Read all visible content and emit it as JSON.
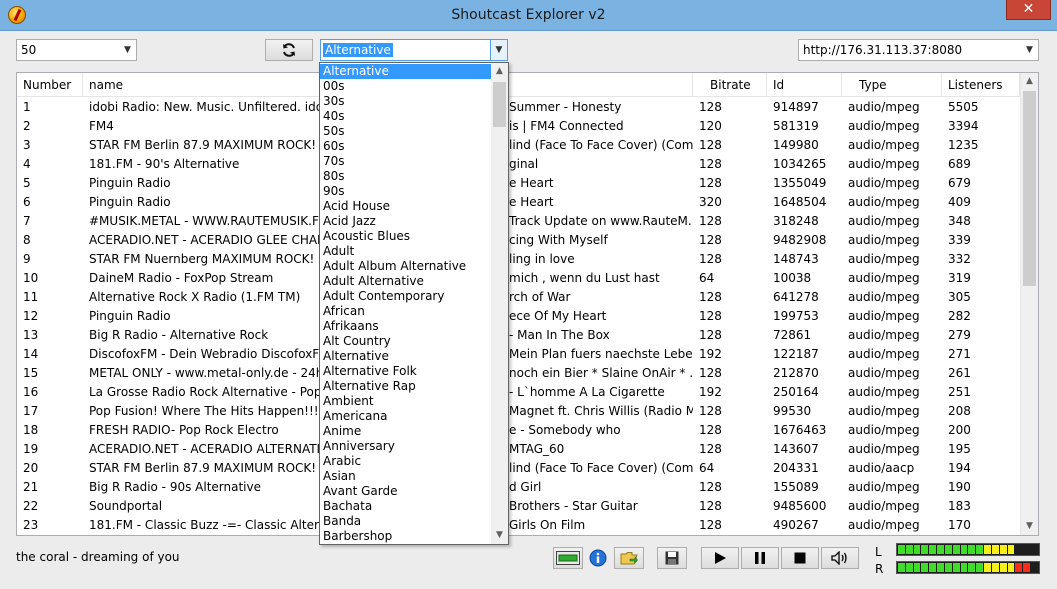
{
  "window": {
    "title": "Shoutcast Explorer v2",
    "close_glyph": "✕"
  },
  "toolbar": {
    "limit_value": "50",
    "refresh_icon": "refresh-icon",
    "genre_value": "Alternative",
    "server_value": "http://176.31.113.37:8080"
  },
  "table": {
    "columns": [
      "Number",
      "name",
      "Bitrate",
      "Id",
      "Type",
      "Listeners"
    ],
    "rows": [
      {
        "number": "1",
        "name": "idobi Radio: New. Music. Unfiltered. idobi.co",
        "song": "Summer - Honesty",
        "bitrate": "128",
        "id": "914897",
        "type": "audio/mpeg",
        "listeners": "5505"
      },
      {
        "number": "2",
        "name": "FM4",
        "song": "is | FM4 Connected",
        "bitrate": "120",
        "id": "581319",
        "type": "audio/mpeg",
        "listeners": "3394"
      },
      {
        "number": "3",
        "name": "STAR FM Berlin 87.9  MAXIMUM ROCK!",
        "song": "lind (Face To Face Cover) (Com...",
        "bitrate": "128",
        "id": "149980",
        "type": "audio/mpeg",
        "listeners": "1235"
      },
      {
        "number": "4",
        "name": "181.FM - 90's Alternative",
        "song": "ginal",
        "bitrate": "128",
        "id": "1034265",
        "type": "audio/mpeg",
        "listeners": "689"
      },
      {
        "number": "5",
        "name": "Pinguin Radio",
        "song": "e Heart",
        "bitrate": "128",
        "id": "1355049",
        "type": "audio/mpeg",
        "listeners": "679"
      },
      {
        "number": "6",
        "name": "Pinguin Radio",
        "song": "e Heart",
        "bitrate": "320",
        "id": "1648504",
        "type": "audio/mpeg",
        "listeners": "409"
      },
      {
        "number": "7",
        "name": "#MUSIK.METAL - WWW.RAUTEMUSIK.FM - 2",
        "song": "Track Update on www.RauteM...",
        "bitrate": "128",
        "id": "318248",
        "type": "audio/mpeg",
        "listeners": "348"
      },
      {
        "number": "8",
        "name": "ACERADIO.NET - ACERADIO GLEE CHANNE",
        "song": "cing With Myself",
        "bitrate": "128",
        "id": "9482908",
        "type": "audio/mpeg",
        "listeners": "339"
      },
      {
        "number": "9",
        "name": "STAR FM Nuernberg MAXIMUM ROCK!",
        "song": "ling in love",
        "bitrate": "128",
        "id": "148743",
        "type": "audio/mpeg",
        "listeners": "332"
      },
      {
        "number": "10",
        "name": "DaineM Radio - FoxPop Stream",
        "song": "mich , wenn du Lust hast",
        "bitrate": "64",
        "id": "10038",
        "type": "audio/mpeg",
        "listeners": "319"
      },
      {
        "number": "11",
        "name": "Alternative Rock X Radio (1.FM TM)",
        "song": "rch of War",
        "bitrate": "128",
        "id": "641278",
        "type": "audio/mpeg",
        "listeners": "305"
      },
      {
        "number": "12",
        "name": "Pinguin Radio",
        "song": "ece Of My Heart",
        "bitrate": "128",
        "id": "199753",
        "type": "audio/mpeg",
        "listeners": "282"
      },
      {
        "number": "13",
        "name": "Big R Radio - Alternative Rock",
        "song": "- Man In The Box",
        "bitrate": "128",
        "id": "72861",
        "type": "audio/mpeg",
        "listeners": "279"
      },
      {
        "number": "14",
        "name": "DiscofoxFM - Dein Webradio DiscofoxFM - N",
        "song": "Mein Plan fuers naechste Leben",
        "bitrate": "192",
        "id": "122187",
        "type": "audio/mpeg",
        "listeners": "271"
      },
      {
        "number": "15",
        "name": "METAL ONLY - www.metal-only.de - 24h Bl",
        "song": "noch ein Bier * Slaine OnAir * ...",
        "bitrate": "128",
        "id": "212870",
        "type": "audio/mpeg",
        "listeners": "261"
      },
      {
        "number": "16",
        "name": "La Grosse Radio Rock Alternative - Pop Hits",
        "song": "- L`homme A La Cigarette",
        "bitrate": "192",
        "id": "250164",
        "type": "audio/mpeg",
        "listeners": "251"
      },
      {
        "number": "17",
        "name": "Pop Fusion! Where The Hits Happen!!!",
        "song": "Magnet ft. Chris Willis (Radio M...",
        "bitrate": "128",
        "id": "99530",
        "type": "audio/mpeg",
        "listeners": "208"
      },
      {
        "number": "18",
        "name": "FRESH RADIO- Pop Rock Electro",
        "song": "e - Somebody who",
        "bitrate": "128",
        "id": "1676463",
        "type": "audio/mpeg",
        "listeners": "200"
      },
      {
        "number": "19",
        "name": "ACERADIO.NET - ACERADIO ALTERNATIVE",
        "song": "MTAG_60",
        "bitrate": "128",
        "id": "143607",
        "type": "audio/mpeg",
        "listeners": "195"
      },
      {
        "number": "20",
        "name": "STAR FM Berlin 87.9  MAXIMUM ROCK!",
        "song": "lind (Face To Face Cover) (Com...",
        "bitrate": "64",
        "id": "204331",
        "type": "audio/aacp",
        "listeners": "194"
      },
      {
        "number": "21",
        "name": "Big R Radio - 90s Alternative",
        "song": "d Girl",
        "bitrate": "128",
        "id": "155089",
        "type": "audio/mpeg",
        "listeners": "190"
      },
      {
        "number": "22",
        "name": "Soundportal",
        "song": "Brothers - Star Guitar",
        "bitrate": "128",
        "id": "9485600",
        "type": "audio/mpeg",
        "listeners": "183"
      },
      {
        "number": "23",
        "name": "181.FM - Classic Buzz -=- Classic Alternative",
        "song": "Girls On Film",
        "bitrate": "128",
        "id": "490267",
        "type": "audio/mpeg",
        "listeners": "170"
      }
    ]
  },
  "genre_dropdown": {
    "selected": "Alternative",
    "items": [
      "Alternative",
      "00s",
      "30s",
      "40s",
      "50s",
      "60s",
      "70s",
      "80s",
      "90s",
      "Acid House",
      "Acid Jazz",
      "Acoustic Blues",
      "Adult",
      "Adult Album Alternative",
      "Adult Alternative",
      "Adult Contemporary",
      "African",
      "Afrikaans",
      "Alt Country",
      "Alternative",
      "Alternative Folk",
      "Alternative Rap",
      "Ambient",
      "Americana",
      "Anime",
      "Anniversary",
      "Arabic",
      "Asian",
      "Avant Garde",
      "Bachata",
      "Banda",
      "Barbershop"
    ]
  },
  "status": {
    "now_playing": "the coral - dreaming of you"
  },
  "player": {
    "icons": [
      "volume-bar-icon",
      "info-icon",
      "open-folder-icon",
      "save-icon",
      "play-icon",
      "pause-icon",
      "stop-icon",
      "speaker-icon"
    ]
  },
  "meters": {
    "left_label": "L",
    "right_label": "R",
    "left_level": 0.86,
    "right_level": 0.93,
    "colors": {
      "green": "#3fdc2a",
      "yellow": "#f6ee1d",
      "red": "#ff2a1a",
      "off": "#1e1e1e"
    }
  },
  "colors": {
    "selection": "#3399ff",
    "titlebar": "#7ab2e2",
    "close": "#c74635"
  }
}
